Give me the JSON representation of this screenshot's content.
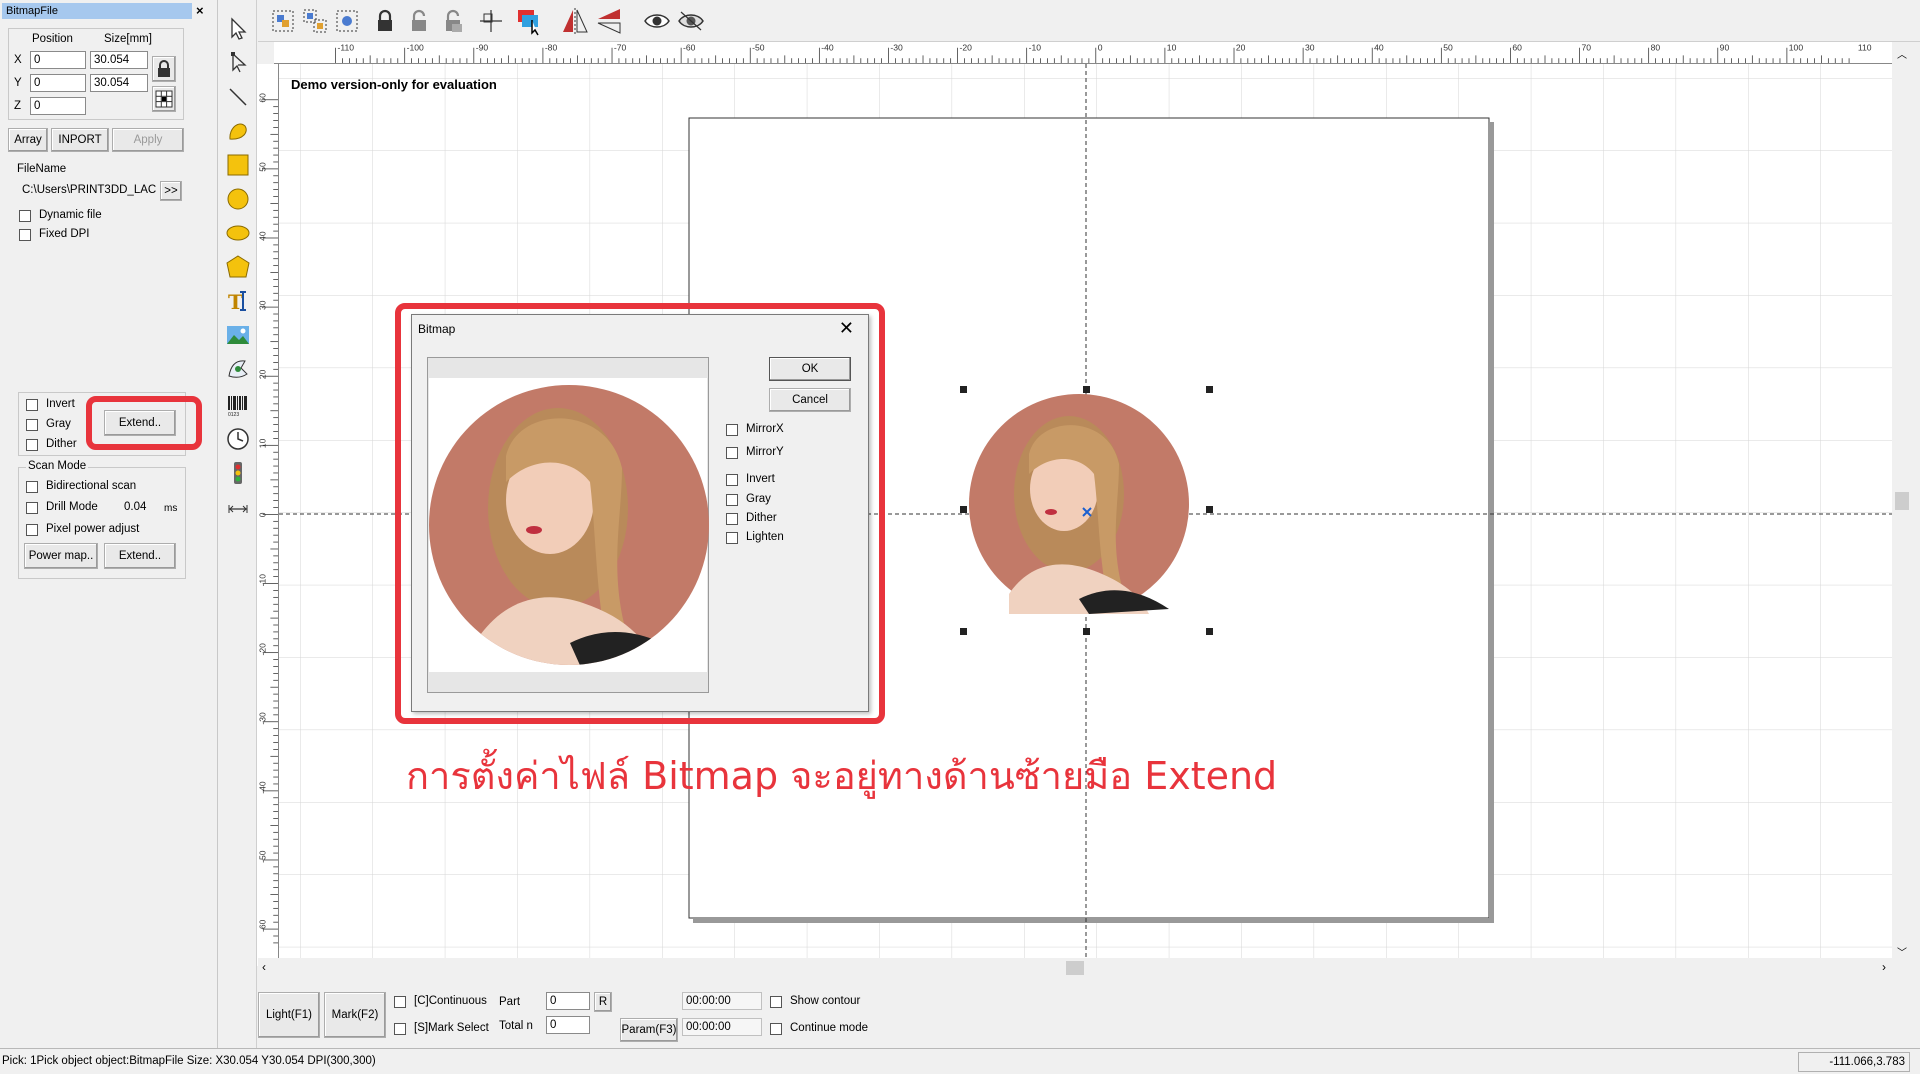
{
  "panel": {
    "title": "BitmapFile",
    "close_glyph": "×",
    "position_header": "Position",
    "size_header": "Size[mm]",
    "x_label": "X",
    "y_label": "Y",
    "z_label": "Z",
    "x_value": "0",
    "y_value": "0",
    "z_value": "0",
    "size_x": "30.054",
    "size_y": "30.054",
    "array_label": "Array",
    "inport_label": "INPORT",
    "apply_label": "Apply",
    "filename_label": "FileName",
    "filename_value": "C:\\Users\\PRINT3DD_LAC",
    "browse_label": ">>",
    "dynamic_file": "Dynamic file",
    "fixed_dpi": "Fixed DPI",
    "invert": "Invert",
    "gray": "Gray",
    "dither": "Dither",
    "extend_label": "Extend..",
    "scan_mode": "Scan Mode",
    "bidirectional": "Bidirectional scan",
    "drill_mode": "Drill Mode",
    "drill_value": "0.04",
    "drill_unit": "ms",
    "pixel_power": "Pixel power adjust",
    "power_map_label": "Power map..",
    "extend2_label": "Extend.."
  },
  "canvas": {
    "demo_text": "Demo version-only for evaluation",
    "ruler_h_labels": [
      "-110",
      "-100",
      "-90",
      "-80",
      "-70",
      "-60",
      "-50",
      "-40",
      "-30",
      "-20",
      "-10",
      "0",
      "10",
      "20",
      "30",
      "40",
      "50",
      "60",
      "70",
      "80",
      "90",
      "100",
      "110"
    ],
    "ruler_v_labels": [
      "60",
      "50",
      "40",
      "30",
      "20",
      "10",
      "0",
      "-10",
      "-20",
      "-30",
      "-40",
      "-50",
      "-60"
    ]
  },
  "dialog": {
    "title": "Bitmap",
    "close_glyph": "✕",
    "ok_label": "OK",
    "cancel_label": "Cancel",
    "mirror_x": "MirrorX",
    "mirror_y": "MirrorY",
    "invert": "Invert",
    "gray": "Gray",
    "dither": "Dither",
    "lighten": "Lighten"
  },
  "callout_text": "การตั้งค่าไฟล์ Bitmap จะอยู่ทางด้านซ้ายมือ Extend",
  "bottom": {
    "light_label": "Light(F1)",
    "mark_label": "Mark(F2)",
    "continuous": "[C]Continuous",
    "mark_select": "[S]Mark Select",
    "part_label": "Part",
    "part_value": "0",
    "r_label": "R",
    "total_label": "Total n",
    "total_value": "0",
    "param_label": "Param(F3)",
    "time1": "00:00:00",
    "time2": "00:00:00",
    "show_contour": "Show contour",
    "continue_mode": "Continue mode"
  },
  "status": {
    "text": "Pick: 1Pick object object:BitmapFile Size: X30.054 Y30.054 DPI(300,300)",
    "coords": "-111.066,3.783"
  },
  "colors": {
    "highlight": "#e8343c",
    "photo_bg": "#c27a68",
    "title_bar": "#a6c8ee"
  },
  "icons": {
    "vertical_toolbar": [
      "select-arrow-icon",
      "node-edit-icon",
      "line-icon",
      "curve-icon",
      "rectangle-icon",
      "circle-icon",
      "ellipse-icon",
      "polygon-icon",
      "text-icon",
      "bitmap-icon",
      "vector-file-icon",
      "barcode-icon",
      "timer-icon",
      "io-port-icon",
      "extend-axis-icon"
    ],
    "horizontal_toolbar": [
      "group-icon",
      "ungroup-icon",
      "combine-icon",
      "lock-icon",
      "unlock-icon",
      "unlock-all-icon",
      "align-icon",
      "color-layer-icon",
      "mirror-horizontal-icon",
      "mirror-vertical-icon",
      "show-icon",
      "hide-icon"
    ]
  }
}
